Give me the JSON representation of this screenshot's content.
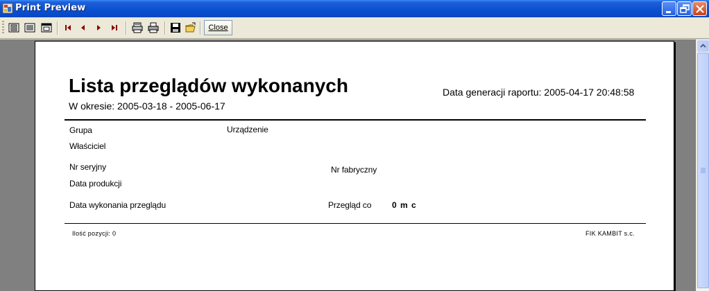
{
  "window": {
    "title": "Print Preview",
    "controls": {
      "minimize": "minimize-icon",
      "restore": "restore-icon",
      "close": "close-icon"
    }
  },
  "toolbar": {
    "buttons": [
      {
        "name": "single-page",
        "icon": "single-page-icon"
      },
      {
        "name": "multi-page",
        "icon": "multi-page-icon"
      },
      {
        "name": "page-width",
        "icon": "page-width-icon"
      },
      {
        "name": "first-page",
        "icon": "first-page-icon"
      },
      {
        "name": "prev-page",
        "icon": "prev-page-icon"
      },
      {
        "name": "next-page",
        "icon": "next-page-icon"
      },
      {
        "name": "last-page",
        "icon": "last-page-icon"
      },
      {
        "name": "print-setup",
        "icon": "print-setup-icon"
      },
      {
        "name": "print",
        "icon": "printer-icon"
      },
      {
        "name": "save",
        "icon": "floppy-icon"
      },
      {
        "name": "open",
        "icon": "open-folder-icon"
      }
    ],
    "close_label": "Close"
  },
  "report": {
    "title": "Lista przeglądów wykonanych",
    "period": "W okresie: 2005-03-18 - 2005-06-17",
    "generated": "Data generacji raportu: 2005-04-17 20:48:58",
    "fields": {
      "group": "Grupa",
      "device": "Urządzenie",
      "owner": "Właściciel",
      "serial": "Nr seryjny",
      "factory_no": "Nr fabryczny",
      "production_date": "Data produkcji",
      "inspection_date": "Data wykonania przeglądu",
      "inspection_every": "Przegląd co",
      "inspection_every_value": "0 m c"
    },
    "footer": {
      "count": "Ilość pozycji: 0",
      "company": "FIK KAMBIT s.c."
    }
  },
  "colors": {
    "titlebar": "#0a4fd0",
    "toolbar": "#ece9d8",
    "preview_bg": "#808080",
    "page": "#ffffff"
  }
}
